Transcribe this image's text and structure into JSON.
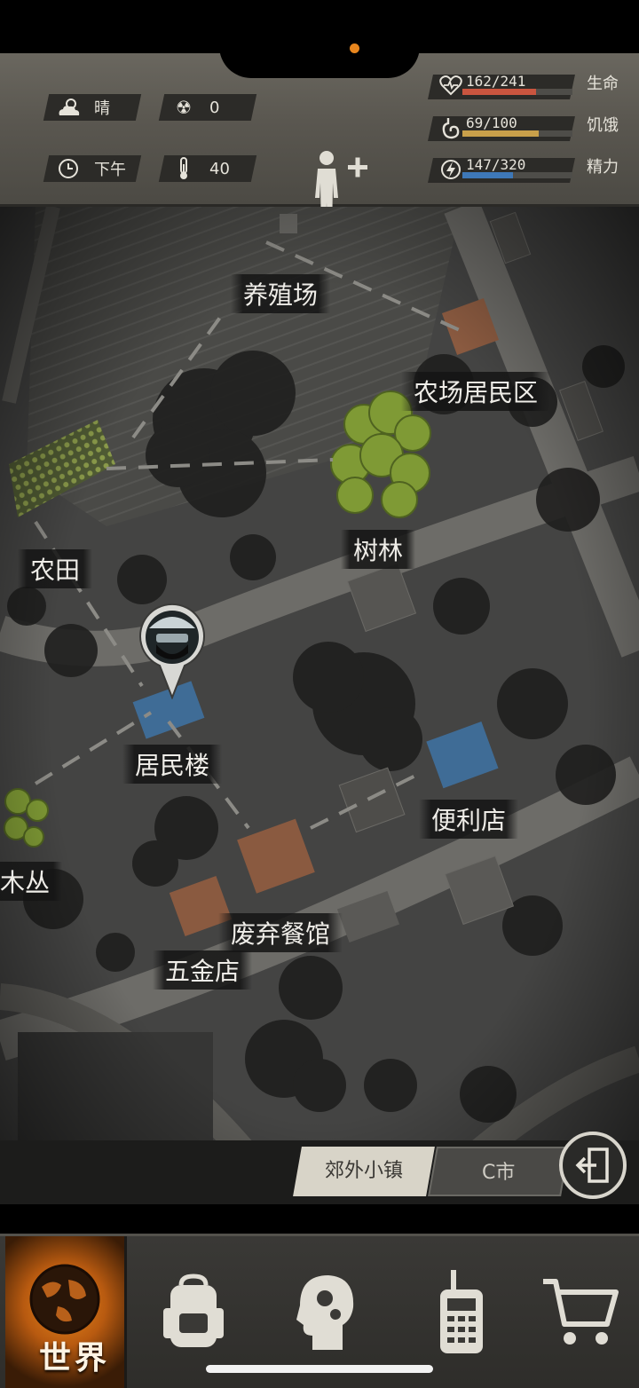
{
  "status": {
    "weather": "晴",
    "radiation": "0",
    "time_of_day": "下午",
    "temperature": "40"
  },
  "vitals": [
    {
      "label": "生命",
      "value": "162/241",
      "fraction": 0.672,
      "color": "#c9553f",
      "icon": "heart-pulse-icon"
    },
    {
      "label": "饥饿",
      "value": "69/100",
      "fraction": 0.69,
      "color": "#c9a04a",
      "icon": "stomach-icon"
    },
    {
      "label": "精力",
      "value": "147/320",
      "fraction": 0.459,
      "color": "#3e78b8",
      "icon": "energy-bolt-icon"
    }
  ],
  "map": {
    "locations": {
      "farm_breeding": "养殖场",
      "farm_residential": "农场居民区",
      "woods": "树林",
      "farmland": "农田",
      "residential_building": "居民楼",
      "convenience_store": "便利店",
      "bushes": "木丛",
      "abandoned_restaurant": "废弃餐馆",
      "hardware_store": "五金店"
    }
  },
  "regions": {
    "active": "郊外小镇",
    "other": "C市"
  },
  "nav": {
    "world_label": "世界",
    "items": [
      "world-icon",
      "backpack-icon",
      "skills-head-icon",
      "radio-icon",
      "shop-cart-icon"
    ]
  }
}
